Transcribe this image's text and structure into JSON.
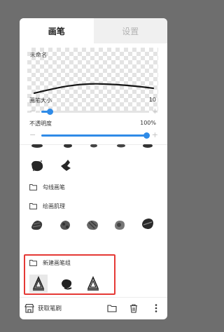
{
  "tabs": {
    "brush": "画笔",
    "settings": "设置"
  },
  "preview": {
    "name": "未命名"
  },
  "size": {
    "label": "画笔大小",
    "value": "10",
    "level": 0.08
  },
  "opacity": {
    "label": "不透明度",
    "value": "100%",
    "level": 1.0
  },
  "slider_symbols": {
    "minus": "−",
    "plus": "+"
  },
  "folders": [
    {
      "label": "勾线画笔"
    },
    {
      "label": "绘画肌理"
    },
    {
      "label": "新建画笔组"
    }
  ],
  "bottom": {
    "get_brush": "获取笔刷"
  },
  "colors": {
    "accent": "#2f8be7",
    "highlight": "#e53935"
  }
}
